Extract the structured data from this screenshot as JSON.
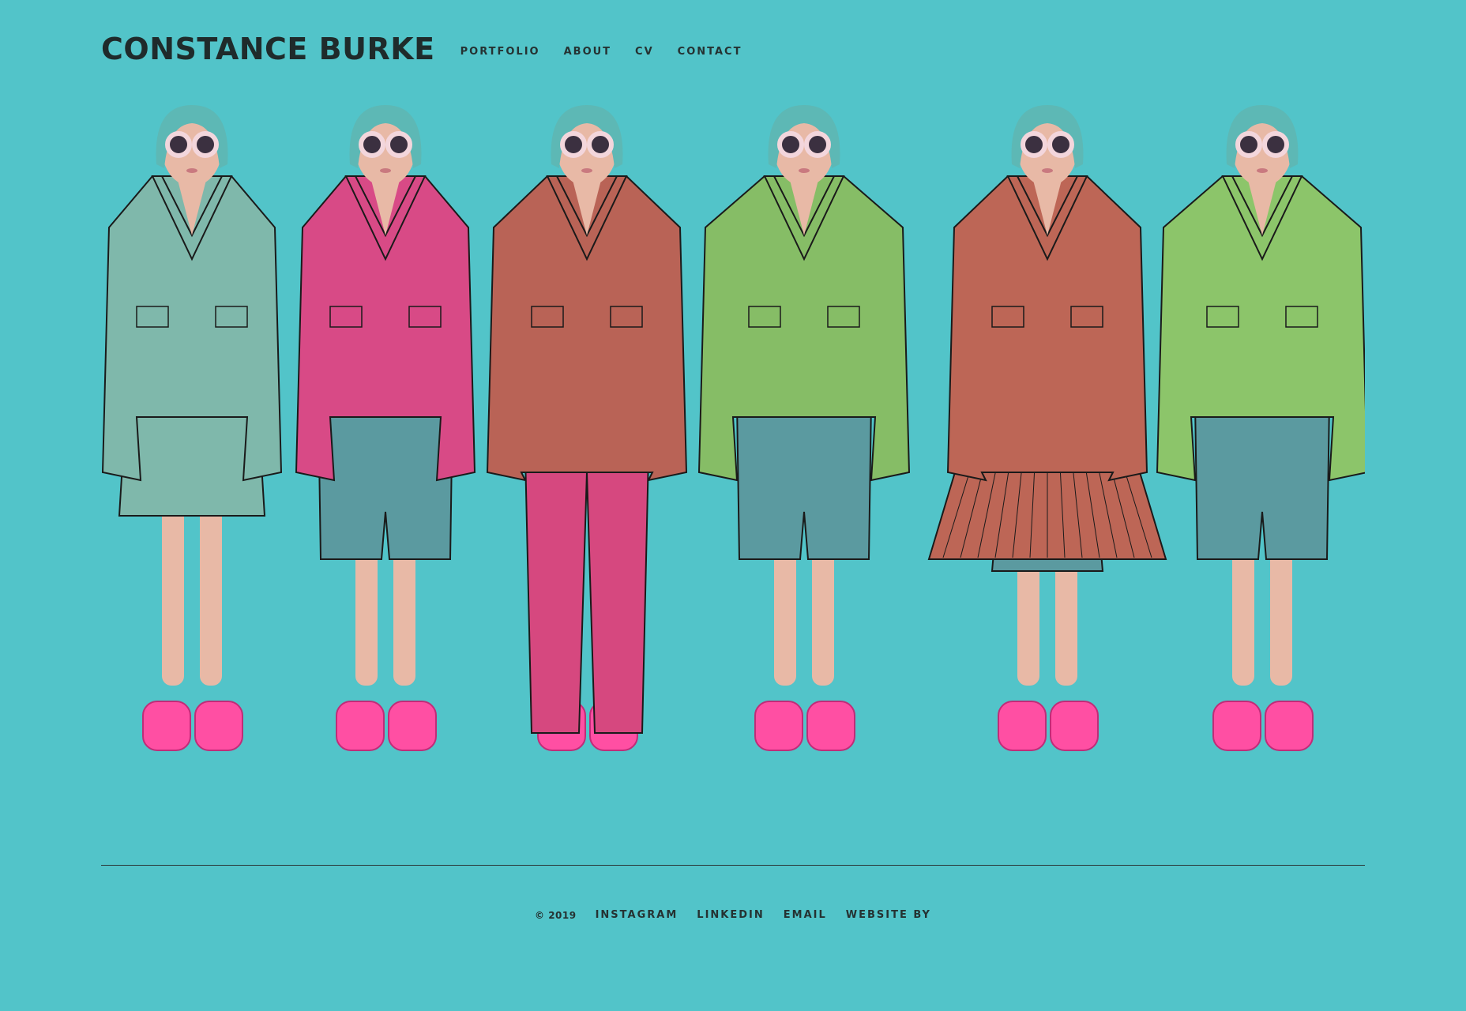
{
  "header": {
    "brand": "CONSTANCE BURKE",
    "nav": [
      {
        "label": "PORTFOLIO"
      },
      {
        "label": "ABOUT"
      },
      {
        "label": "CV"
      },
      {
        "label": "CONTACT"
      }
    ]
  },
  "hero": {
    "figures": [
      {
        "outfit": "mint-dress",
        "top": "#7fb8ab",
        "bottom": "#7fb8ab",
        "bottom_style": "dress"
      },
      {
        "outfit": "pink-jacket-leopard-romper",
        "top": "#d84a86",
        "bottom": "#5b9aa0",
        "bottom_style": "shorts"
      },
      {
        "outfit": "rust-coat-pink-jumpsuit",
        "top": "#b96356",
        "bottom": "#d6487f",
        "bottom_style": "trousers"
      },
      {
        "outfit": "green-leather-jacket",
        "top": "#86bd66",
        "bottom": "#5b9aa0",
        "bottom_style": "shorts"
      },
      {
        "outfit": "rust-pleated-dress",
        "top": "#bd6656",
        "bottom": "#bd6656",
        "bottom_style": "pleated"
      },
      {
        "outfit": "green-leather-coat",
        "top": "#8cc56a",
        "bottom": "#5b9aa0",
        "bottom_style": "shorts"
      }
    ],
    "colors": {
      "hair": "#5db8b5",
      "skin": "#e8b9a6",
      "shoe": "#ff4fa3",
      "glasses": "#f3d6dc"
    }
  },
  "footer": {
    "copyright": "© 2019",
    "links": [
      {
        "label": "INSTAGRAM"
      },
      {
        "label": "LINKEDIN"
      },
      {
        "label": "EMAIL"
      },
      {
        "label": "WEBSITE BY"
      }
    ]
  },
  "theme": {
    "background": "#52c4c9"
  }
}
